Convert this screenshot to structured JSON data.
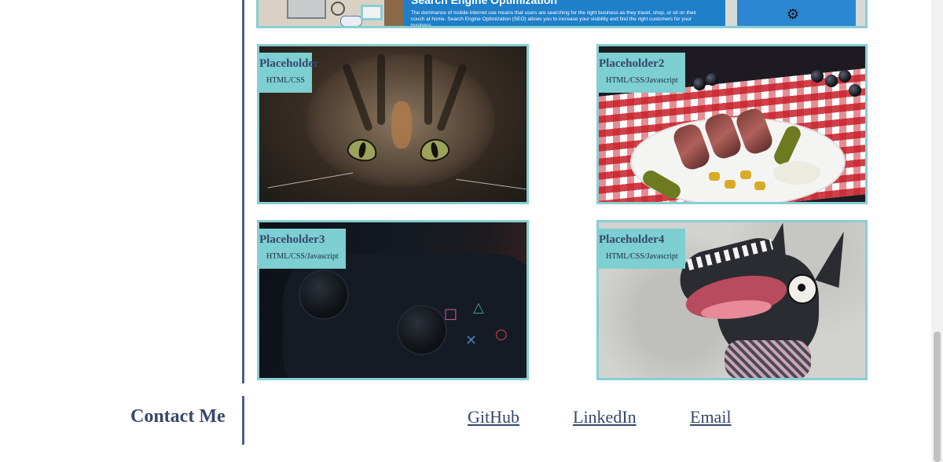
{
  "banner": {
    "title": "Search Engine Optimization",
    "body": "The dominance of mobile internet use means that users are searching for the right business as they travel, shop, or sit on their couch at home. Search Engine Optimization (SEO) allows you to increase your visibility and find the right customers for your business."
  },
  "projects": [
    {
      "title": "Placeholder",
      "tech": "HTML/CSS",
      "image": "cat-photo"
    },
    {
      "title": "Placeholder2",
      "tech": "HTML/CSS/Javascript",
      "image": "food-plate-photo"
    },
    {
      "title": "Placeholder3",
      "tech": "HTML/CSS/Javascript",
      "image": "game-controller-photo"
    },
    {
      "title": "Placeholder4",
      "tech": "HTML/CSS/Javascript",
      "image": "wolf-illustration"
    }
  ],
  "contact": {
    "title": "Contact Me",
    "links": [
      "GitHub",
      "LinkedIn",
      "Email"
    ]
  },
  "colors": {
    "accent": "#87cfd3",
    "label_bg": "#7dcfd1",
    "heading": "#36476b",
    "divider": "#4a5f85"
  }
}
